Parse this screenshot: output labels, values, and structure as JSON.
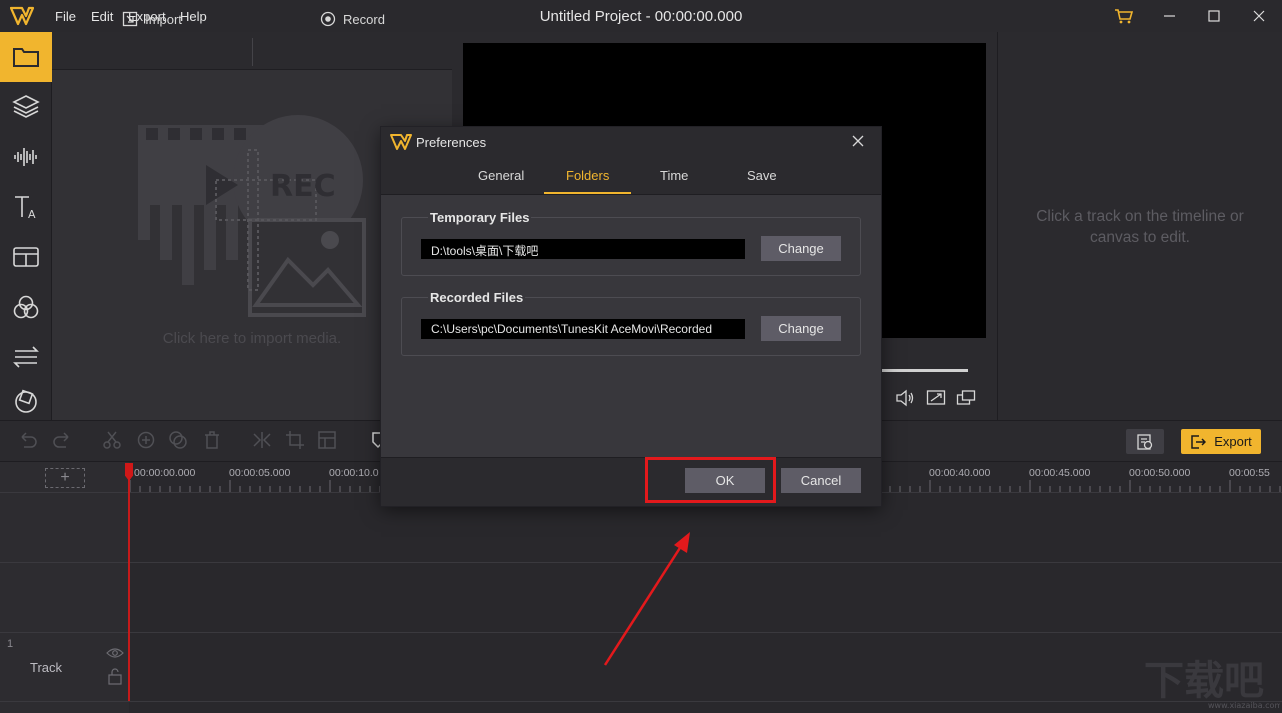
{
  "app": {
    "title": "Untitled Project - 00:00:00.000",
    "menu": [
      "File",
      "Edit",
      "Export",
      "Help"
    ],
    "accent_color": "#f1b52e"
  },
  "sidebar": {
    "items": [
      {
        "icon": "folder-icon",
        "active": true
      },
      {
        "icon": "layers-icon",
        "active": false
      },
      {
        "icon": "audio-wave-icon",
        "active": false
      },
      {
        "icon": "text-icon",
        "active": false
      },
      {
        "icon": "template-icon",
        "active": false
      },
      {
        "icon": "filter-icon",
        "active": false
      },
      {
        "icon": "transition-icon",
        "active": false
      },
      {
        "icon": "element-icon",
        "active": false
      }
    ]
  },
  "media": {
    "import_label": "Import",
    "record_label": "Record",
    "hint": "Click here to import media.",
    "placeholder_rec_text": "REC"
  },
  "properties": {
    "hint": "Click a track on the timeline or canvas to edit."
  },
  "toolbar": {
    "export_label": "Export"
  },
  "timeline": {
    "ticks": [
      "00:00:00.000",
      "00:00:05.000",
      "00:00:10.0",
      "00:00:40.000",
      "00:00:45.000",
      "00:00:50.000",
      "00:00:55"
    ],
    "track_number": "1",
    "track_label": "Track"
  },
  "dialog": {
    "title": "Preferences",
    "tabs": [
      "General",
      "Folders",
      "Time",
      "Save"
    ],
    "active_tab": "Folders",
    "temporary": {
      "title": "Temporary Files",
      "path": "D:\\tools\\桌面\\下载吧",
      "button": "Change"
    },
    "recorded": {
      "title": "Recorded Files",
      "path": "C:\\Users\\pc\\Documents\\TunesKit AceMovi\\Recorded",
      "button": "Change"
    },
    "ok_label": "OK",
    "cancel_label": "Cancel",
    "highlight_color": "#e3191c"
  },
  "watermark": {
    "text": "下载吧",
    "url": "www.xiazaiba.com"
  }
}
